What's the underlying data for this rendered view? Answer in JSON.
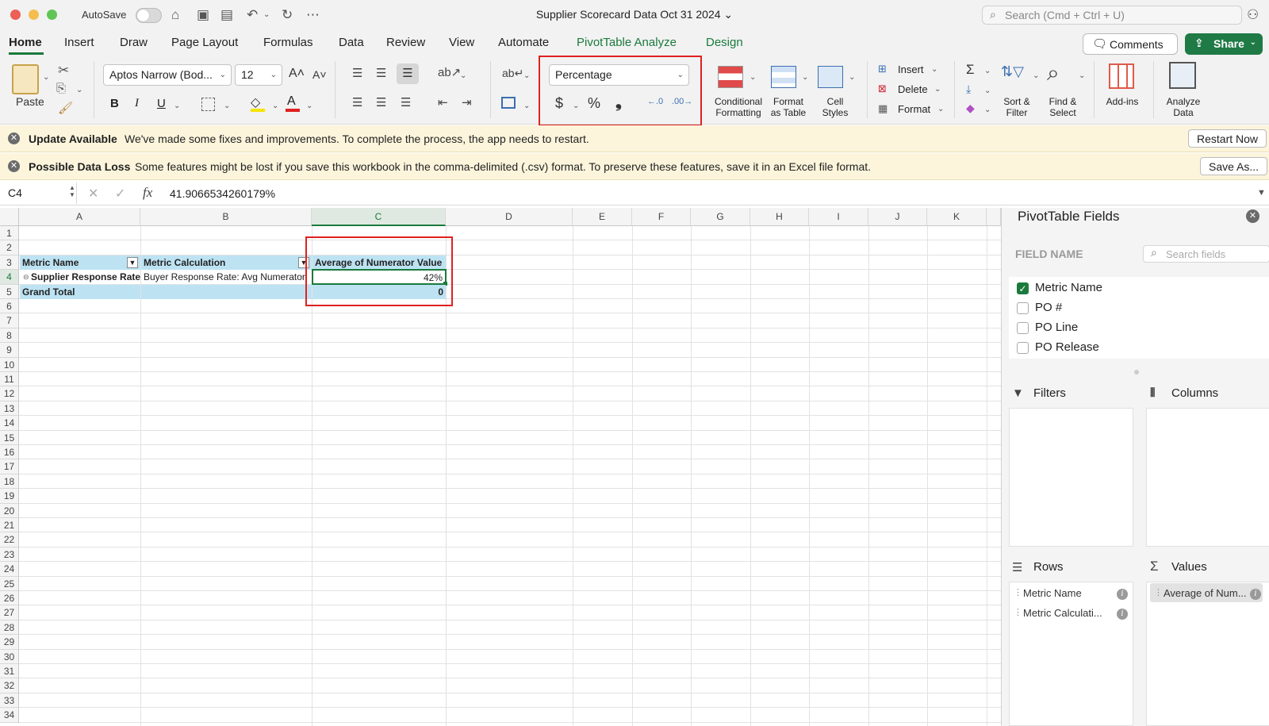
{
  "titlebar": {
    "autosave_label": "AutoSave",
    "doc_title": "Supplier Scorecard Data Oct 31 2024",
    "search_placeholder": "Search (Cmd + Ctrl + U)"
  },
  "ribbon_tabs": [
    "Home",
    "Insert",
    "Draw",
    "Page Layout",
    "Formulas",
    "Data",
    "Review",
    "View",
    "Automate",
    "PivotTable Analyze",
    "Design"
  ],
  "ribbon_actions": {
    "comments": "Comments",
    "share": "Share"
  },
  "ribbon": {
    "paste": "Paste",
    "font_name": "Aptos Narrow (Bod...",
    "font_size": "12",
    "number_format": "Percentage",
    "conditional_formatting": [
      "Conditional",
      "Formatting"
    ],
    "format_as_table": [
      "Format",
      "as Table"
    ],
    "cell_styles": [
      "Cell",
      "Styles"
    ],
    "insert": "Insert",
    "delete": "Delete",
    "format": "Format",
    "sort_filter": [
      "Sort &",
      "Filter"
    ],
    "find_select": [
      "Find &",
      "Select"
    ],
    "add_ins": "Add-ins",
    "analyze_data": [
      "Analyze",
      "Data"
    ]
  },
  "notices": [
    {
      "title": "Update Available",
      "message": "We've made some fixes and improvements. To complete the process, the app needs to restart.",
      "action": "Restart Now"
    },
    {
      "title": "Possible Data Loss",
      "message": "Some features might be lost if you save this workbook in the comma-delimited (.csv) format. To preserve these features, save it in an Excel file format.",
      "action": "Save As..."
    }
  ],
  "formula_bar": {
    "name_box": "C4",
    "fx": "fx",
    "value": "41.9066534260179%"
  },
  "grid": {
    "columns": [
      "A",
      "B",
      "C",
      "D",
      "E",
      "F",
      "G",
      "H",
      "I",
      "J",
      "K"
    ],
    "rows": [
      "1",
      "2",
      "3",
      "4",
      "5",
      "6",
      "7",
      "8",
      "9",
      "10",
      "11",
      "12",
      "13",
      "14",
      "15",
      "16",
      "17",
      "18",
      "19",
      "20",
      "21",
      "22",
      "23",
      "24",
      "25",
      "26",
      "27",
      "28",
      "29",
      "30",
      "31",
      "32",
      "33",
      "34"
    ],
    "pivot": {
      "header_a": "Metric Name",
      "header_b": "Metric Calculation",
      "header_c": "Average of Numerator Value",
      "row_a": "Supplier Response Rate",
      "row_b": "Buyer Response Rate: Avg Numerator",
      "row_c": "42%",
      "total_a": "Grand Total",
      "total_c": "0"
    }
  },
  "pivot_pane": {
    "title": "PivotTable Fields",
    "field_name_label": "FIELD NAME",
    "search_placeholder": "Search fields",
    "fields": [
      {
        "label": "Metric Name",
        "checked": true
      },
      {
        "label": "PO #",
        "checked": false
      },
      {
        "label": "PO Line",
        "checked": false
      },
      {
        "label": "PO Release",
        "checked": false
      }
    ],
    "areas": {
      "filters": "Filters",
      "columns": "Columns",
      "rows": "Rows",
      "values": "Values"
    },
    "rows_items": [
      "Metric Name",
      "Metric Calculati..."
    ],
    "values_items": [
      "Average of Num..."
    ]
  }
}
